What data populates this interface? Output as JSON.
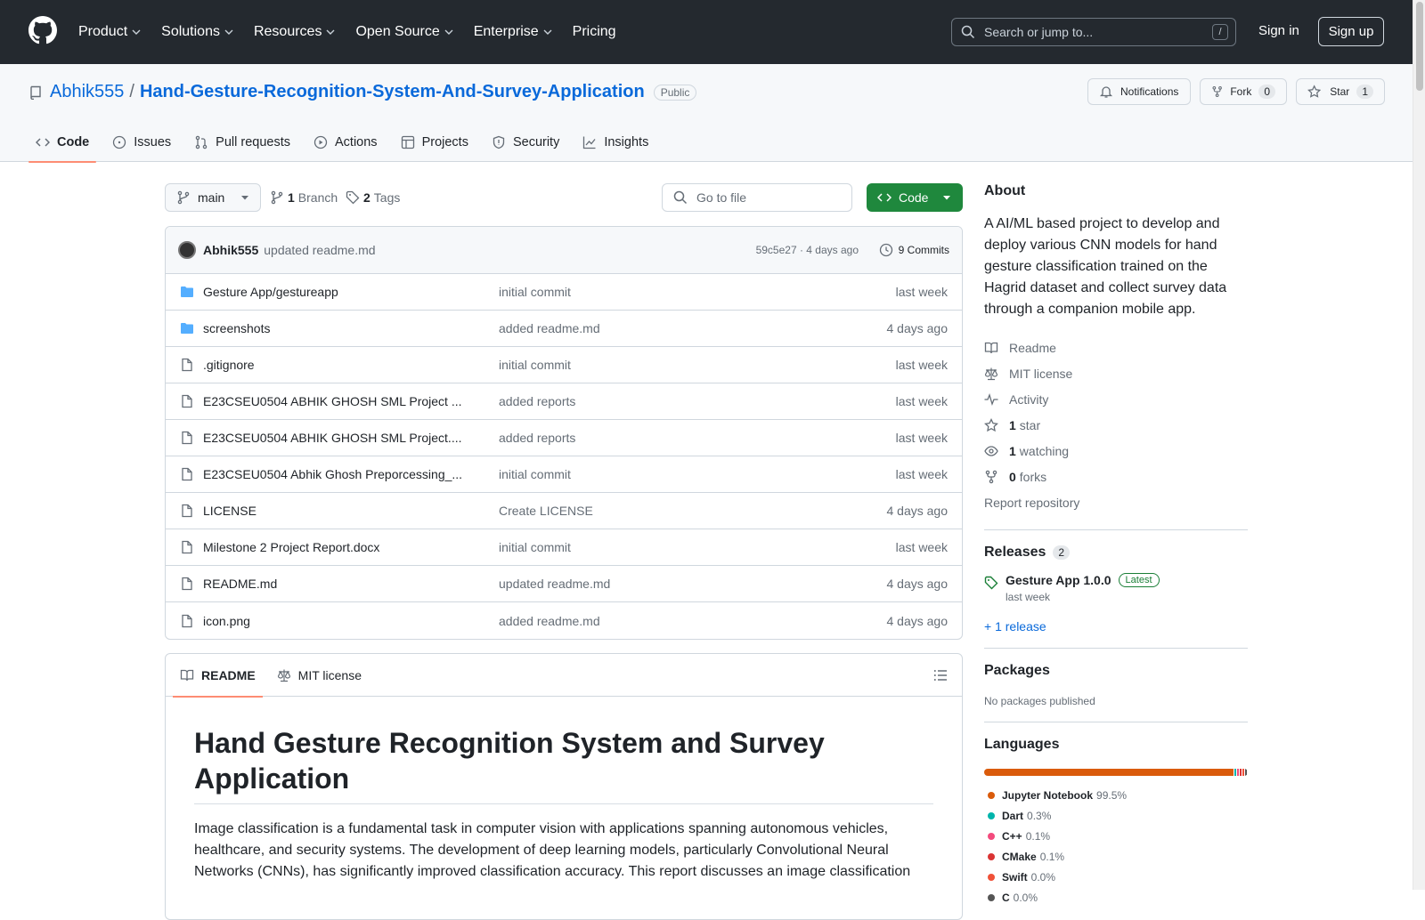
{
  "header": {
    "nav": [
      "Product",
      "Solutions",
      "Resources",
      "Open Source",
      "Enterprise",
      "Pricing"
    ],
    "search_placeholder": "Search or jump to...",
    "search_shortcut": "/",
    "signin": "Sign in",
    "signup": "Sign up"
  },
  "repo": {
    "owner": "Abhik555",
    "separator": "/",
    "name": "Hand-Gesture-Recognition-System-And-Survey-Application",
    "visibility": "Public",
    "notifications": "Notifications",
    "fork_label": "Fork",
    "fork_count": "0",
    "star_label": "Star",
    "star_count": "1"
  },
  "tabs": [
    "Code",
    "Issues",
    "Pull requests",
    "Actions",
    "Projects",
    "Security",
    "Insights"
  ],
  "toolbar": {
    "branch": "main",
    "branch_count": "1",
    "branch_label": "Branch",
    "tag_count": "2",
    "tag_label": "Tags",
    "go_to_file": "Go to file",
    "code_button": "Code"
  },
  "commit": {
    "author": "Abhik555",
    "message": "updated readme.md",
    "sha": "59c5e27 · 4 days ago",
    "commits": "9 Commits"
  },
  "files": [
    {
      "name": "Gesture App/gestureapp",
      "type": "folder",
      "message": "initial commit",
      "time": "last week"
    },
    {
      "name": "screenshots",
      "type": "folder",
      "message": "added readme.md",
      "time": "4 days ago"
    },
    {
      "name": ".gitignore",
      "type": "file",
      "message": "initial commit",
      "time": "last week"
    },
    {
      "name": "E23CSEU0504 ABHIK GHOSH SML Project ...",
      "type": "file",
      "message": "added reports",
      "time": "last week"
    },
    {
      "name": "E23CSEU0504 ABHIK GHOSH SML Project....",
      "type": "file",
      "message": "added reports",
      "time": "last week"
    },
    {
      "name": "E23CSEU0504 Abhik Ghosh Preporcessing_...",
      "type": "file",
      "message": "initial commit",
      "time": "last week"
    },
    {
      "name": "LICENSE",
      "type": "file",
      "message": "Create LICENSE",
      "time": "4 days ago"
    },
    {
      "name": "Milestone 2 Project Report.docx",
      "type": "file",
      "message": "initial commit",
      "time": "last week"
    },
    {
      "name": "README.md",
      "type": "file",
      "message": "updated readme.md",
      "time": "4 days ago"
    },
    {
      "name": "icon.png",
      "type": "file",
      "message": "added readme.md",
      "time": "4 days ago"
    }
  ],
  "readme": {
    "tab_readme": "README",
    "tab_license": "MIT license",
    "title": "Hand Gesture Recognition System and Survey Application",
    "body": "Image classification is a fundamental task in computer vision with applications spanning autonomous vehicles, healthcare, and security systems. The development of deep learning models, particularly Convolutional Neural Networks (CNNs), has significantly improved classification accuracy. This report discusses an image classification"
  },
  "about": {
    "heading": "About",
    "description": "A AI/ML based project to develop and deploy various CNN models for hand gesture classification trained on the Hagrid dataset and collect survey data through a companion mobile app.",
    "readme": "Readme",
    "license": "MIT license",
    "activity": "Activity",
    "stars_n": "1",
    "stars": "star",
    "watching_n": "1",
    "watching": "watching",
    "forks_n": "0",
    "forks": "forks",
    "report": "Report repository"
  },
  "releases": {
    "heading": "Releases",
    "count": "2",
    "name": "Gesture App 1.0.0",
    "badge": "Latest",
    "time": "last week",
    "more": "+ 1 release"
  },
  "packages": {
    "heading": "Packages",
    "text": "No packages published"
  },
  "languages": {
    "heading": "Languages",
    "items": [
      {
        "name": "Jupyter Notebook",
        "pct": "99.5%",
        "value": 99.5,
        "color": "#DA5B0B"
      },
      {
        "name": "Dart",
        "pct": "0.3%",
        "value": 0.3,
        "color": "#00B4AB"
      },
      {
        "name": "C++",
        "pct": "0.1%",
        "value": 0.1,
        "color": "#f34b7d"
      },
      {
        "name": "CMake",
        "pct": "0.1%",
        "value": 0.1,
        "color": "#DA3434"
      },
      {
        "name": "Swift",
        "pct": "0.0%",
        "value": 0.05,
        "color": "#F05138"
      },
      {
        "name": "C",
        "pct": "0.0%",
        "value": 0.05,
        "color": "#555555"
      }
    ]
  }
}
